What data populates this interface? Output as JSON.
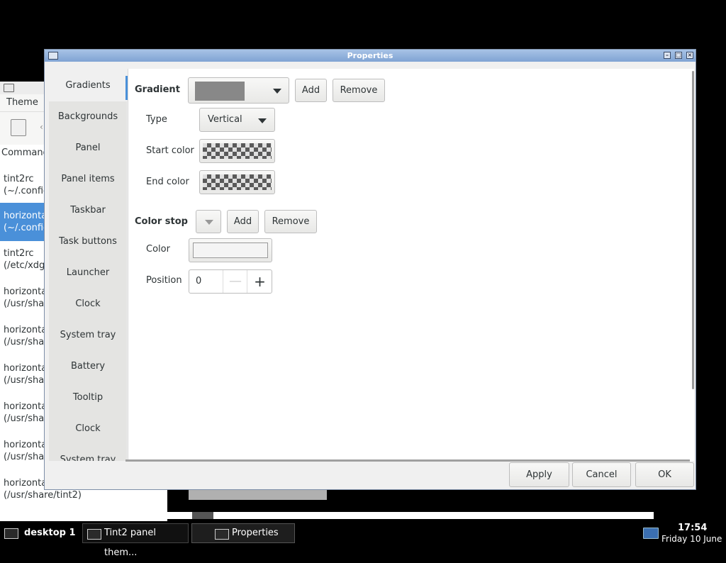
{
  "background_window": {
    "menu": "Theme",
    "column_header": "Command",
    "items": [
      {
        "line1": "tint2rc",
        "line2": "(~/.config"
      },
      {
        "line1": "horizonta",
        "line2": "(~/.config"
      },
      {
        "line1": "tint2rc",
        "line2": "(/etc/xdg"
      },
      {
        "line1": "horizonta",
        "line2": "(/usr/sha"
      },
      {
        "line1": "horizonta",
        "line2": "(/usr/sha"
      },
      {
        "line1": "horizonta",
        "line2": "(/usr/sha"
      },
      {
        "line1": "horizonta",
        "line2": "(/usr/sha"
      },
      {
        "line1": "horizonta",
        "line2": "(/usr/sha"
      },
      {
        "line1": "horizonta",
        "line2": "(/usr/share/tint2)"
      }
    ]
  },
  "dialog": {
    "title": "Properties",
    "sidebar": [
      "Gradients",
      "Backgrounds",
      "Panel",
      "Panel items",
      "Taskbar",
      "Task buttons",
      "Launcher",
      "Clock",
      "System tray",
      "Battery",
      "Tooltip",
      "Clock",
      "System tray"
    ],
    "gradient": {
      "label": "Gradient",
      "add": "Add",
      "remove": "Remove",
      "swatch_color": "#888888",
      "type_label": "Type",
      "type_value": "Vertical",
      "start_color_label": "Start color",
      "end_color_label": "End color"
    },
    "color_stop": {
      "label": "Color stop",
      "add": "Add",
      "remove": "Remove",
      "color_label": "Color",
      "position_label": "Position",
      "position_value": "0"
    },
    "actions": {
      "apply": "Apply",
      "cancel": "Cancel",
      "ok": "OK"
    }
  },
  "taskbar": {
    "desktop": "desktop 1",
    "tasks": [
      "Tint2 panel them...",
      "Properties"
    ],
    "time": "17:54",
    "date": "Friday 10 June"
  }
}
